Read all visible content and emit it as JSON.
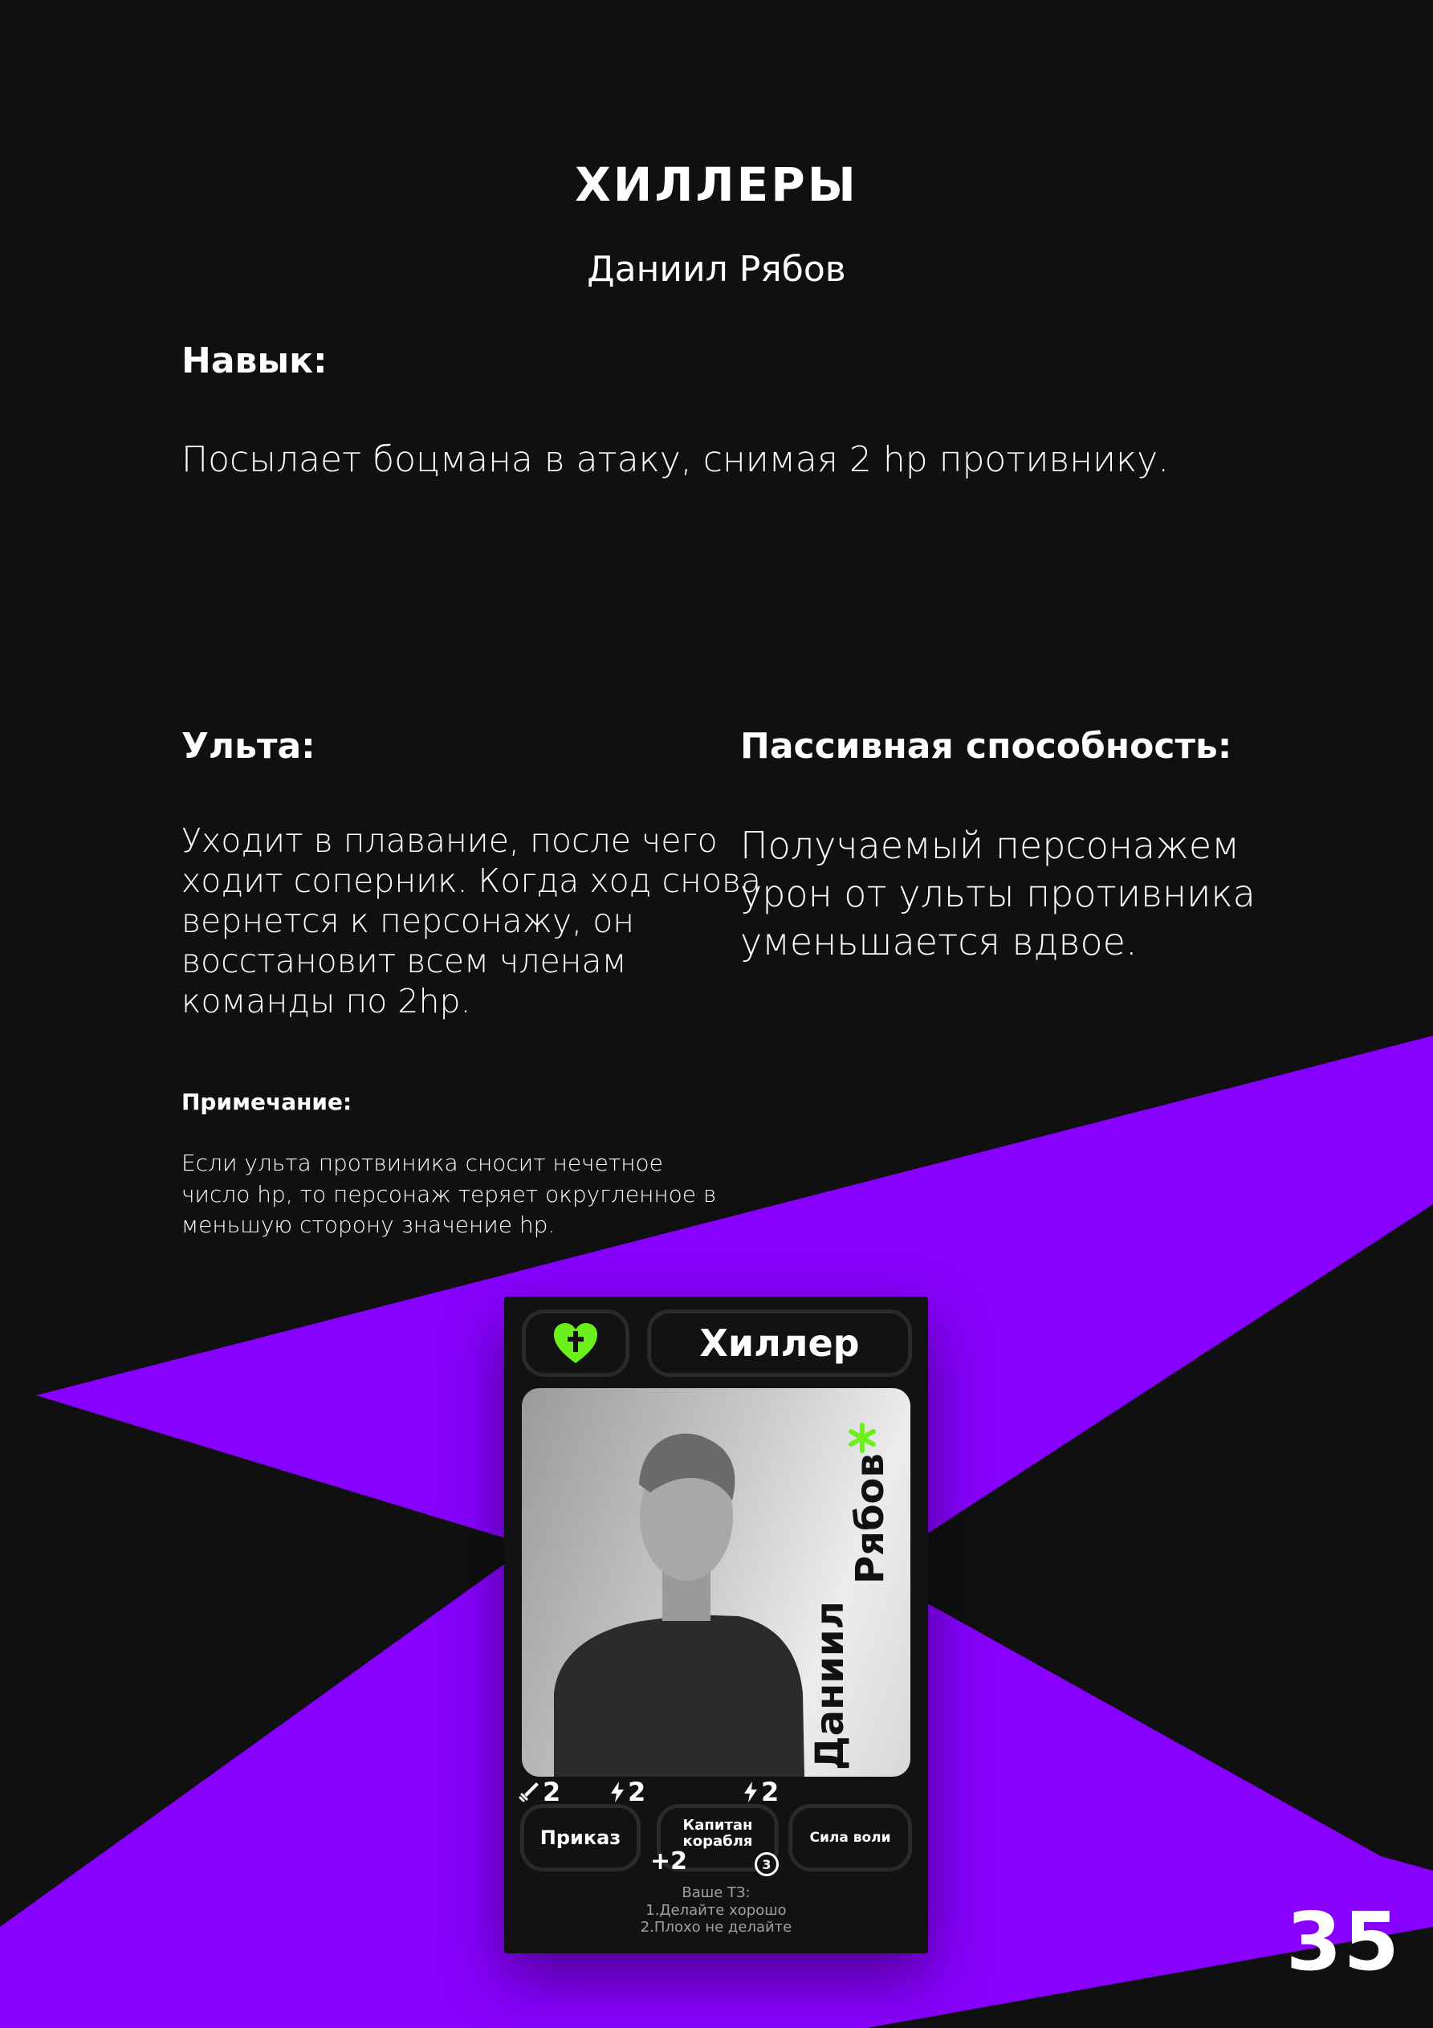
{
  "header": {
    "title": "ХИЛЛЕРЫ",
    "subtitle": "Даниил Рябов"
  },
  "skill": {
    "heading": "Навык:",
    "text": "Посылает боцмана в атаку, снимая 2 hp противнику."
  },
  "ult": {
    "heading": "Ульта:",
    "lines": [
      "Уходит в плавание, после чего",
      "ходит соперник. Когда ход снова",
      "вернется к персонажу, он",
      "восстановит всем членам",
      "команды по 2hp."
    ]
  },
  "passive": {
    "heading": "Пассивная способность:",
    "lines": [
      "Получаемый персонажем",
      "урон от ульты противника",
      "уменьшается вдвое."
    ]
  },
  "note": {
    "heading": "Примечание:",
    "lines": [
      "Если ульта протвиника сносит нечетное",
      "число hp, то персонаж теряет округленное в",
      "меньшую сторону значение hp."
    ]
  },
  "card": {
    "class_name": "Хиллер",
    "class_icon": "heart-cross-icon",
    "first_name": "Даниил",
    "last_name": "Рябов",
    "stats": {
      "attack": "2",
      "energy_a": "2",
      "energy_b": "2",
      "plus": "+2",
      "count": "3"
    },
    "abilities": [
      "Приказ",
      "Капитан корабля",
      "Сила воли"
    ],
    "footer_lines": [
      "Ваше ТЗ:",
      "1.Делайте хорошо",
      "2.Плохо не делайте"
    ]
  },
  "page_number": "35",
  "colors": {
    "background": "#101010",
    "accent_purple": "#8800ff",
    "accent_green": "#6cf01c",
    "text": "#ffffff"
  }
}
